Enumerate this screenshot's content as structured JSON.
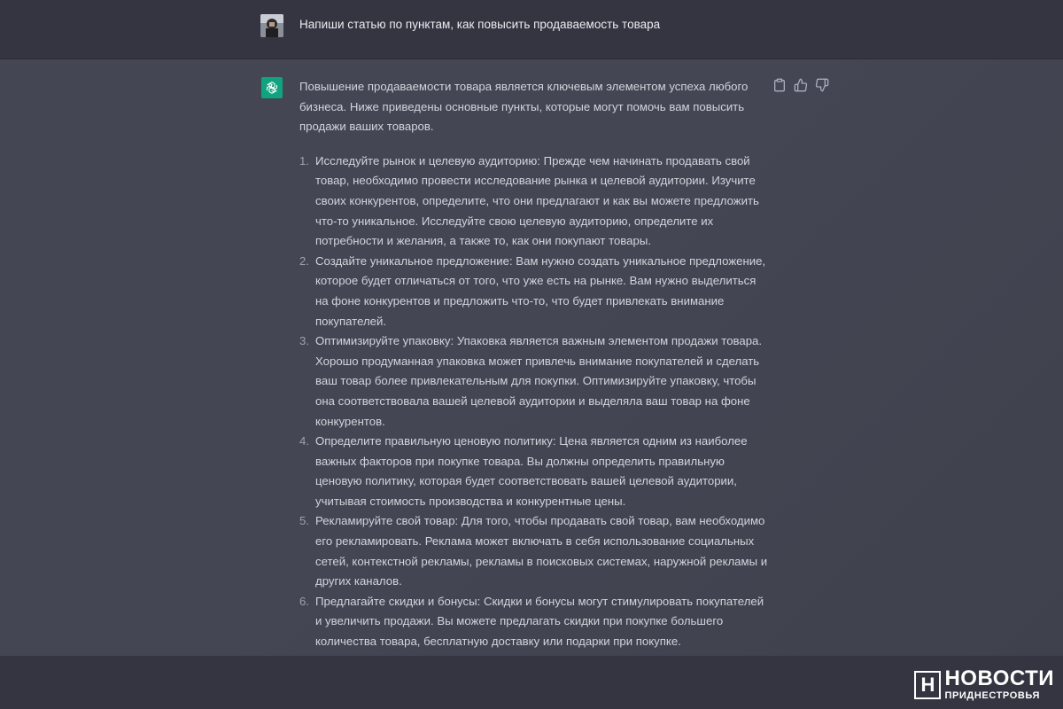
{
  "user_message": {
    "avatar": "user-avatar",
    "text": "Напиши статью по пунктам, как повысить продаваемость товара"
  },
  "assistant_message": {
    "avatar": "openai-logo-icon",
    "intro": "Повышение продаваемости товара является ключевым элементом успеха любого бизнеса. Ниже приведены основные пункты, которые могут помочь вам повысить продажи ваших товаров.",
    "items": [
      {
        "num": "1.",
        "text": "Исследуйте рынок и целевую аудиторию: Прежде чем начинать продавать свой товар, необходимо провести исследование рынка и целевой аудитории. Изучите своих конкурентов, определите, что они предлагают и как вы можете предложить что-то уникальное. Исследуйте свою целевую аудиторию, определите их потребности и желания, а также то, как они покупают товары."
      },
      {
        "num": "2.",
        "text": "Создайте уникальное предложение: Вам нужно создать уникальное предложение, которое будет отличаться от того, что уже есть на рынке. Вам нужно выделиться на фоне конкурентов и предложить что-то, что будет привлекать внимание покупателей."
      },
      {
        "num": "3.",
        "text": "Оптимизируйте упаковку: Упаковка является важным элементом продажи товара. Хорошо продуманная упаковка может привлечь внимание покупателей и сделать ваш товар более привлекательным для покупки. Оптимизируйте упаковку, чтобы она соответствовала вашей целевой аудитории и выделяла ваш товар на фоне конкурентов."
      },
      {
        "num": "4.",
        "text": "Определите правильную ценовую политику: Цена является одним из наиболее важных факторов при покупке товара. Вы должны определить правильную ценовую политику, которая будет соответствовать вашей целевой аудитории, учитывая стоимость производства и конкурентные цены."
      },
      {
        "num": "5.",
        "text": "Рекламируйте свой товар: Для того, чтобы продавать свой товар, вам необходимо его рекламировать. Реклама может включать в себя использование социальных сетей, контекстной рекламы, рекламы в поисковых системах, наружной рекламы и других каналов."
      },
      {
        "num": "6.",
        "text": "Предлагайте скидки и бонусы: Скидки и бонусы могут стимулировать покупателей и увеличить продажи. Вы можете предлагать скидки при покупке большего количества товара, бесплатную доставку или подарки при покупке."
      }
    ],
    "actions": [
      {
        "name": "copy-icon"
      },
      {
        "name": "thumbs-up-icon"
      },
      {
        "name": "thumbs-down-icon"
      }
    ]
  },
  "watermark": {
    "logo_letter": "Н",
    "title": "НОВОСТИ",
    "subtitle": "ПРИДНЕСТРОВЬЯ"
  },
  "colors": {
    "background": "#343541",
    "assistant_bg": "#444654",
    "accent": "#10a37f",
    "text": "#d1d5db"
  }
}
